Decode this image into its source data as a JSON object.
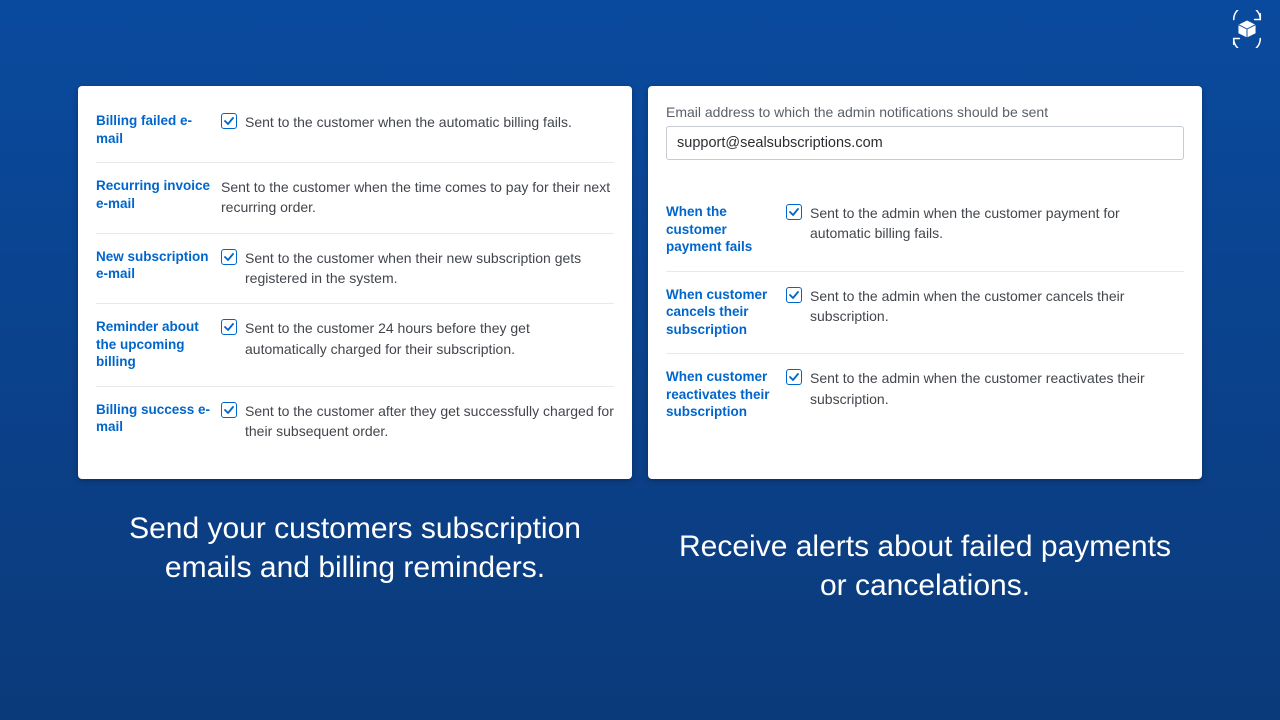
{
  "customer_emails": {
    "rows": [
      {
        "label": "Billing failed e-mail",
        "checked": true,
        "desc": "Sent to the customer when the automatic billing fails."
      },
      {
        "label": "Recurring invoice e-mail",
        "checked": null,
        "desc": "Sent to the customer when the time comes to pay for their next recurring order."
      },
      {
        "label": "New subscription e-mail",
        "checked": true,
        "desc": "Sent to the customer when their new subscription gets registered in the system."
      },
      {
        "label": "Reminder about the upcoming billing",
        "checked": true,
        "desc": "Sent to the customer 24 hours before they get automatically charged for their subscription."
      },
      {
        "label": "Billing success e-mail",
        "checked": true,
        "desc": "Sent to the customer after they get successfully charged for their subsequent order."
      }
    ]
  },
  "admin_notifications": {
    "email_label": "Email address to which the admin notifications should be sent",
    "email_value": "support@sealsubscriptions.com",
    "rows": [
      {
        "label": "When the customer payment fails",
        "checked": true,
        "desc": "Sent to the admin when the customer payment for automatic billing fails."
      },
      {
        "label": "When customer cancels their subscription",
        "checked": true,
        "desc": "Sent to the admin when the customer cancels their subscription."
      },
      {
        "label": "When customer reactivates their subscription",
        "checked": true,
        "desc": "Sent to the admin when the customer reactivates their subscription."
      }
    ]
  },
  "captions": {
    "left": "Send your customers subscription emails and billing reminders.",
    "right": "Receive alerts about failed payments or cancelations."
  }
}
